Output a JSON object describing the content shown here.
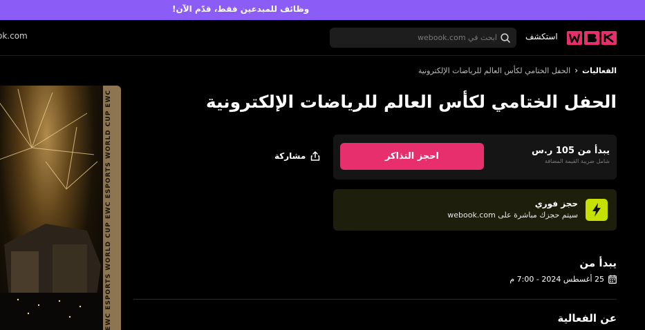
{
  "banner": {
    "text": "وظائف للمبدعين فقط، قدّم الآن!"
  },
  "header": {
    "logo_text": "WBK",
    "explore_label": "استكشف",
    "search_placeholder": "ابحث في webook.com",
    "domain_partial": "ok.com"
  },
  "breadcrumb": {
    "root": "الفعاليات",
    "current": "الحفل الختامي لكأس العالم للرياضات الإلكترونية"
  },
  "event": {
    "title": "الحفل الختامي لكأس العالم للرياضات الإلكترونية"
  },
  "pricing": {
    "starts_label": "يبدأ من",
    "amount": "105",
    "currency": "ر.س",
    "vat_note": "شامل ضريبة القيمة المضافة",
    "book_button": "احجز التذاكر"
  },
  "share": {
    "label": "مشاركة"
  },
  "instant": {
    "title": "حجز فوري",
    "description": "سيتم حجزك مباشرة على webook.com"
  },
  "schedule": {
    "heading": "يبدأ من",
    "date_time": "25 أغسطس 2024 - 7:00 م"
  },
  "about": {
    "heading": "عن الفعالية"
  },
  "poster": {
    "strip_text": "EWC ESPORTS WORLD CUP EWC ESPORTS WORLD CUP EWC"
  },
  "colors": {
    "banner": "#8b5cf6",
    "brand": "#e72f6e",
    "instant_icon": "#c6e000"
  }
}
